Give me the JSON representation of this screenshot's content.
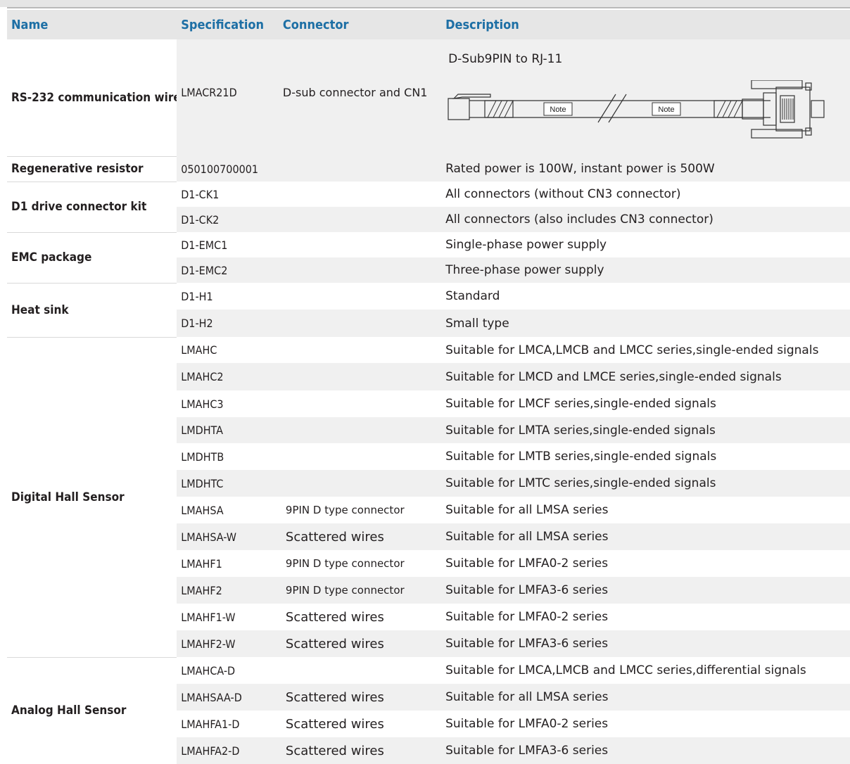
{
  "headers": {
    "name": "Name",
    "spec": "Specification",
    "connector": "Connector",
    "description": "Description"
  },
  "rs232": {
    "name": "RS-232 communication wire",
    "spec": "LMACR21D",
    "connector": "D-sub connector and CN1",
    "description": "D-Sub9PIN to RJ-11",
    "note_left": "Note",
    "note_right": "Note"
  },
  "rows": [
    {
      "name": "Regenerative resistor",
      "spec": "050100700001",
      "connector": "",
      "description": "Rated power is 100W, instant power is 500W"
    },
    {
      "name": "D1 drive connector kit",
      "spec": "D1-CK1",
      "connector": "",
      "description": "All connectors (without CN3 connector)"
    },
    {
      "name": "",
      "spec": "D1-CK2",
      "connector": "",
      "description": "All connectors (also includes CN3 connector)"
    },
    {
      "name": "EMC package",
      "spec": "D1-EMC1",
      "connector": "",
      "description": "Single-phase power supply"
    },
    {
      "name": "",
      "spec": "D1-EMC2",
      "connector": "",
      "description": "Three-phase power supply"
    },
    {
      "name": "Heat sink",
      "spec": "D1-H1",
      "connector": "",
      "description": "Standard"
    },
    {
      "name": "",
      "spec": "D1-H2",
      "connector": "",
      "description": "Small type"
    },
    {
      "name": "Digital Hall Sensor",
      "spec": "LMAHC",
      "connector": "",
      "description": "Suitable for LMCA,LMCB and LMCC series,single-ended signals"
    },
    {
      "name": "",
      "spec": "LMAHC2",
      "connector": "",
      "description": "Suitable for LMCD and LMCE series,single-ended signals"
    },
    {
      "name": "",
      "spec": "LMAHC3",
      "connector": "",
      "description": "Suitable for LMCF series,single-ended signals"
    },
    {
      "name": "",
      "spec": "LMDHTA",
      "connector": "",
      "description": "Suitable for LMTA series,single-ended signals"
    },
    {
      "name": "",
      "spec": "LMDHTB",
      "connector": "",
      "description": "Suitable for LMTB series,single-ended signals"
    },
    {
      "name": "",
      "spec": "LMDHTC",
      "connector": "",
      "description": "Suitable for LMTC series,single-ended signals"
    },
    {
      "name": "",
      "spec": "LMAHSA",
      "connector": "9PIN D type connector",
      "description": "Suitable for all LMSA series"
    },
    {
      "name": "",
      "spec": "LMAHSA-W",
      "connector": "Scattered wires",
      "description": "Suitable for all LMSA series"
    },
    {
      "name": "",
      "spec": "LMAHF1",
      "connector": "9PIN D type connector",
      "description": "Suitable for LMFA0-2 series"
    },
    {
      "name": "",
      "spec": "LMAHF2",
      "connector": "9PIN D type connector",
      "description": "Suitable for LMFA3-6 series"
    },
    {
      "name": "",
      "spec": "LMAHF1-W",
      "connector": "Scattered wires",
      "description": "Suitable for LMFA0-2 series"
    },
    {
      "name": "",
      "spec": "LMAHF2-W",
      "connector": "Scattered wires",
      "description": "Suitable for LMFA3-6 series"
    },
    {
      "name": "Analog Hall Sensor",
      "spec": "LMAHCA-D",
      "connector": "",
      "description": "Suitable for LMCA,LMCB and LMCC series,differential signals"
    },
    {
      "name": "",
      "spec": "LMAHSAA-D",
      "connector": "Scattered wires",
      "description": "Suitable for all LMSA series"
    },
    {
      "name": "",
      "spec": "LMAHFA1-D",
      "connector": "Scattered wires",
      "description": "Suitable for LMFA0-2 series"
    },
    {
      "name": "",
      "spec": "LMAHFA2-D",
      "connector": "Scattered wires",
      "description": "Suitable for LMFA3-6 series"
    }
  ]
}
